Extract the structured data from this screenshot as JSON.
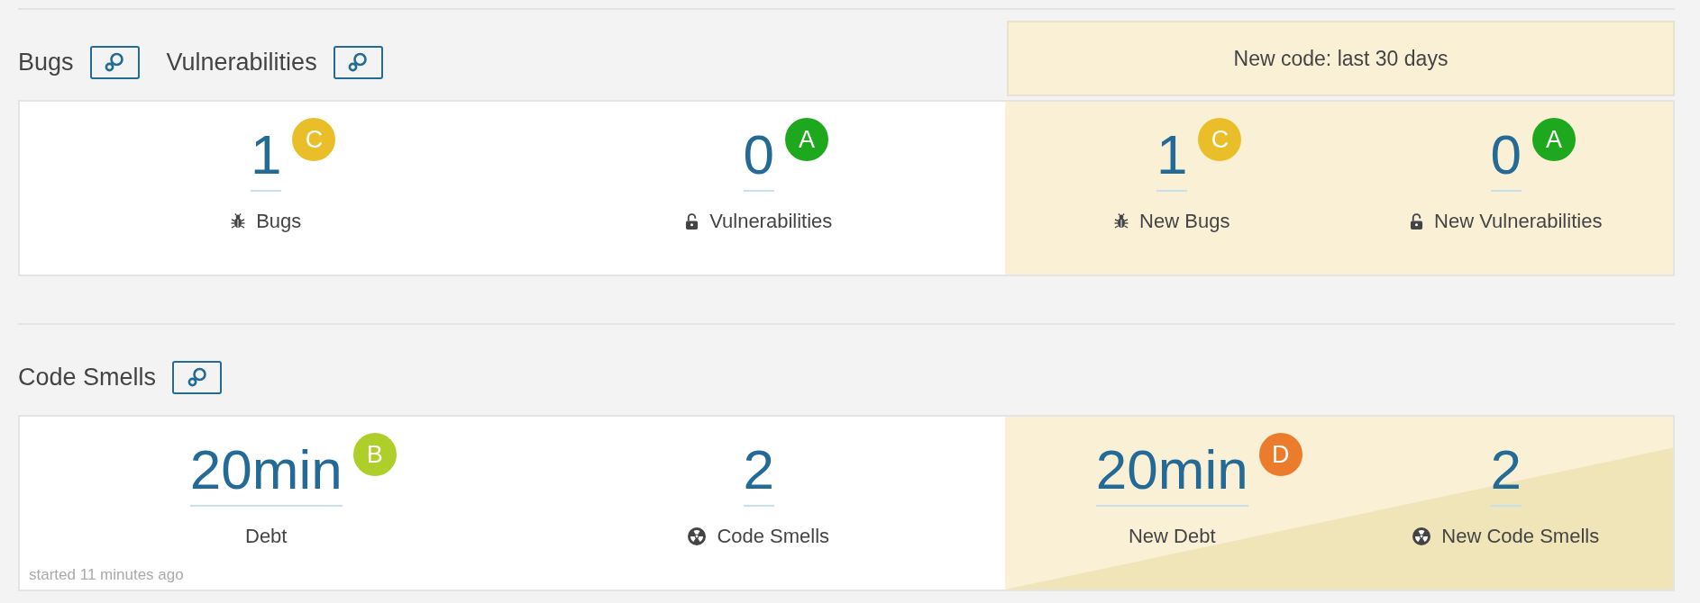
{
  "sections": [
    {
      "titles": [
        {
          "text": "Bugs"
        },
        {
          "text": "Vulnerabilities"
        }
      ],
      "new_code_label": "New code: last 30 days",
      "overall": [
        {
          "kind": "bug",
          "value": "1",
          "rating": "C",
          "color": "#eabe28",
          "label": "Bugs"
        },
        {
          "kind": "vulnerability",
          "value": "0",
          "rating": "A",
          "color": "#1ea81e",
          "label": "Vulnerabilities"
        }
      ],
      "new_code": [
        {
          "kind": "bug",
          "value": "1",
          "rating": "C",
          "color": "#eabe28",
          "label": "New Bugs"
        },
        {
          "kind": "vulnerability",
          "value": "0",
          "rating": "A",
          "color": "#1ea81e",
          "label": "New Vulnerabilities"
        }
      ]
    },
    {
      "titles": [
        {
          "text": "Code Smells"
        }
      ],
      "overall": [
        {
          "kind": "debt",
          "value": "20min",
          "rating": "B",
          "color": "#aece2a",
          "label": "Debt"
        },
        {
          "kind": "smell",
          "value": "2",
          "label": "Code Smells"
        }
      ],
      "new_code": [
        {
          "kind": "debt",
          "value": "20min",
          "rating": "D",
          "color": "#ea7c2c",
          "label": "New Debt"
        },
        {
          "kind": "smell",
          "value": "2",
          "label": "New Code Smells"
        }
      ],
      "footnote": "started 11 minutes ago",
      "shaded": true
    }
  ]
}
